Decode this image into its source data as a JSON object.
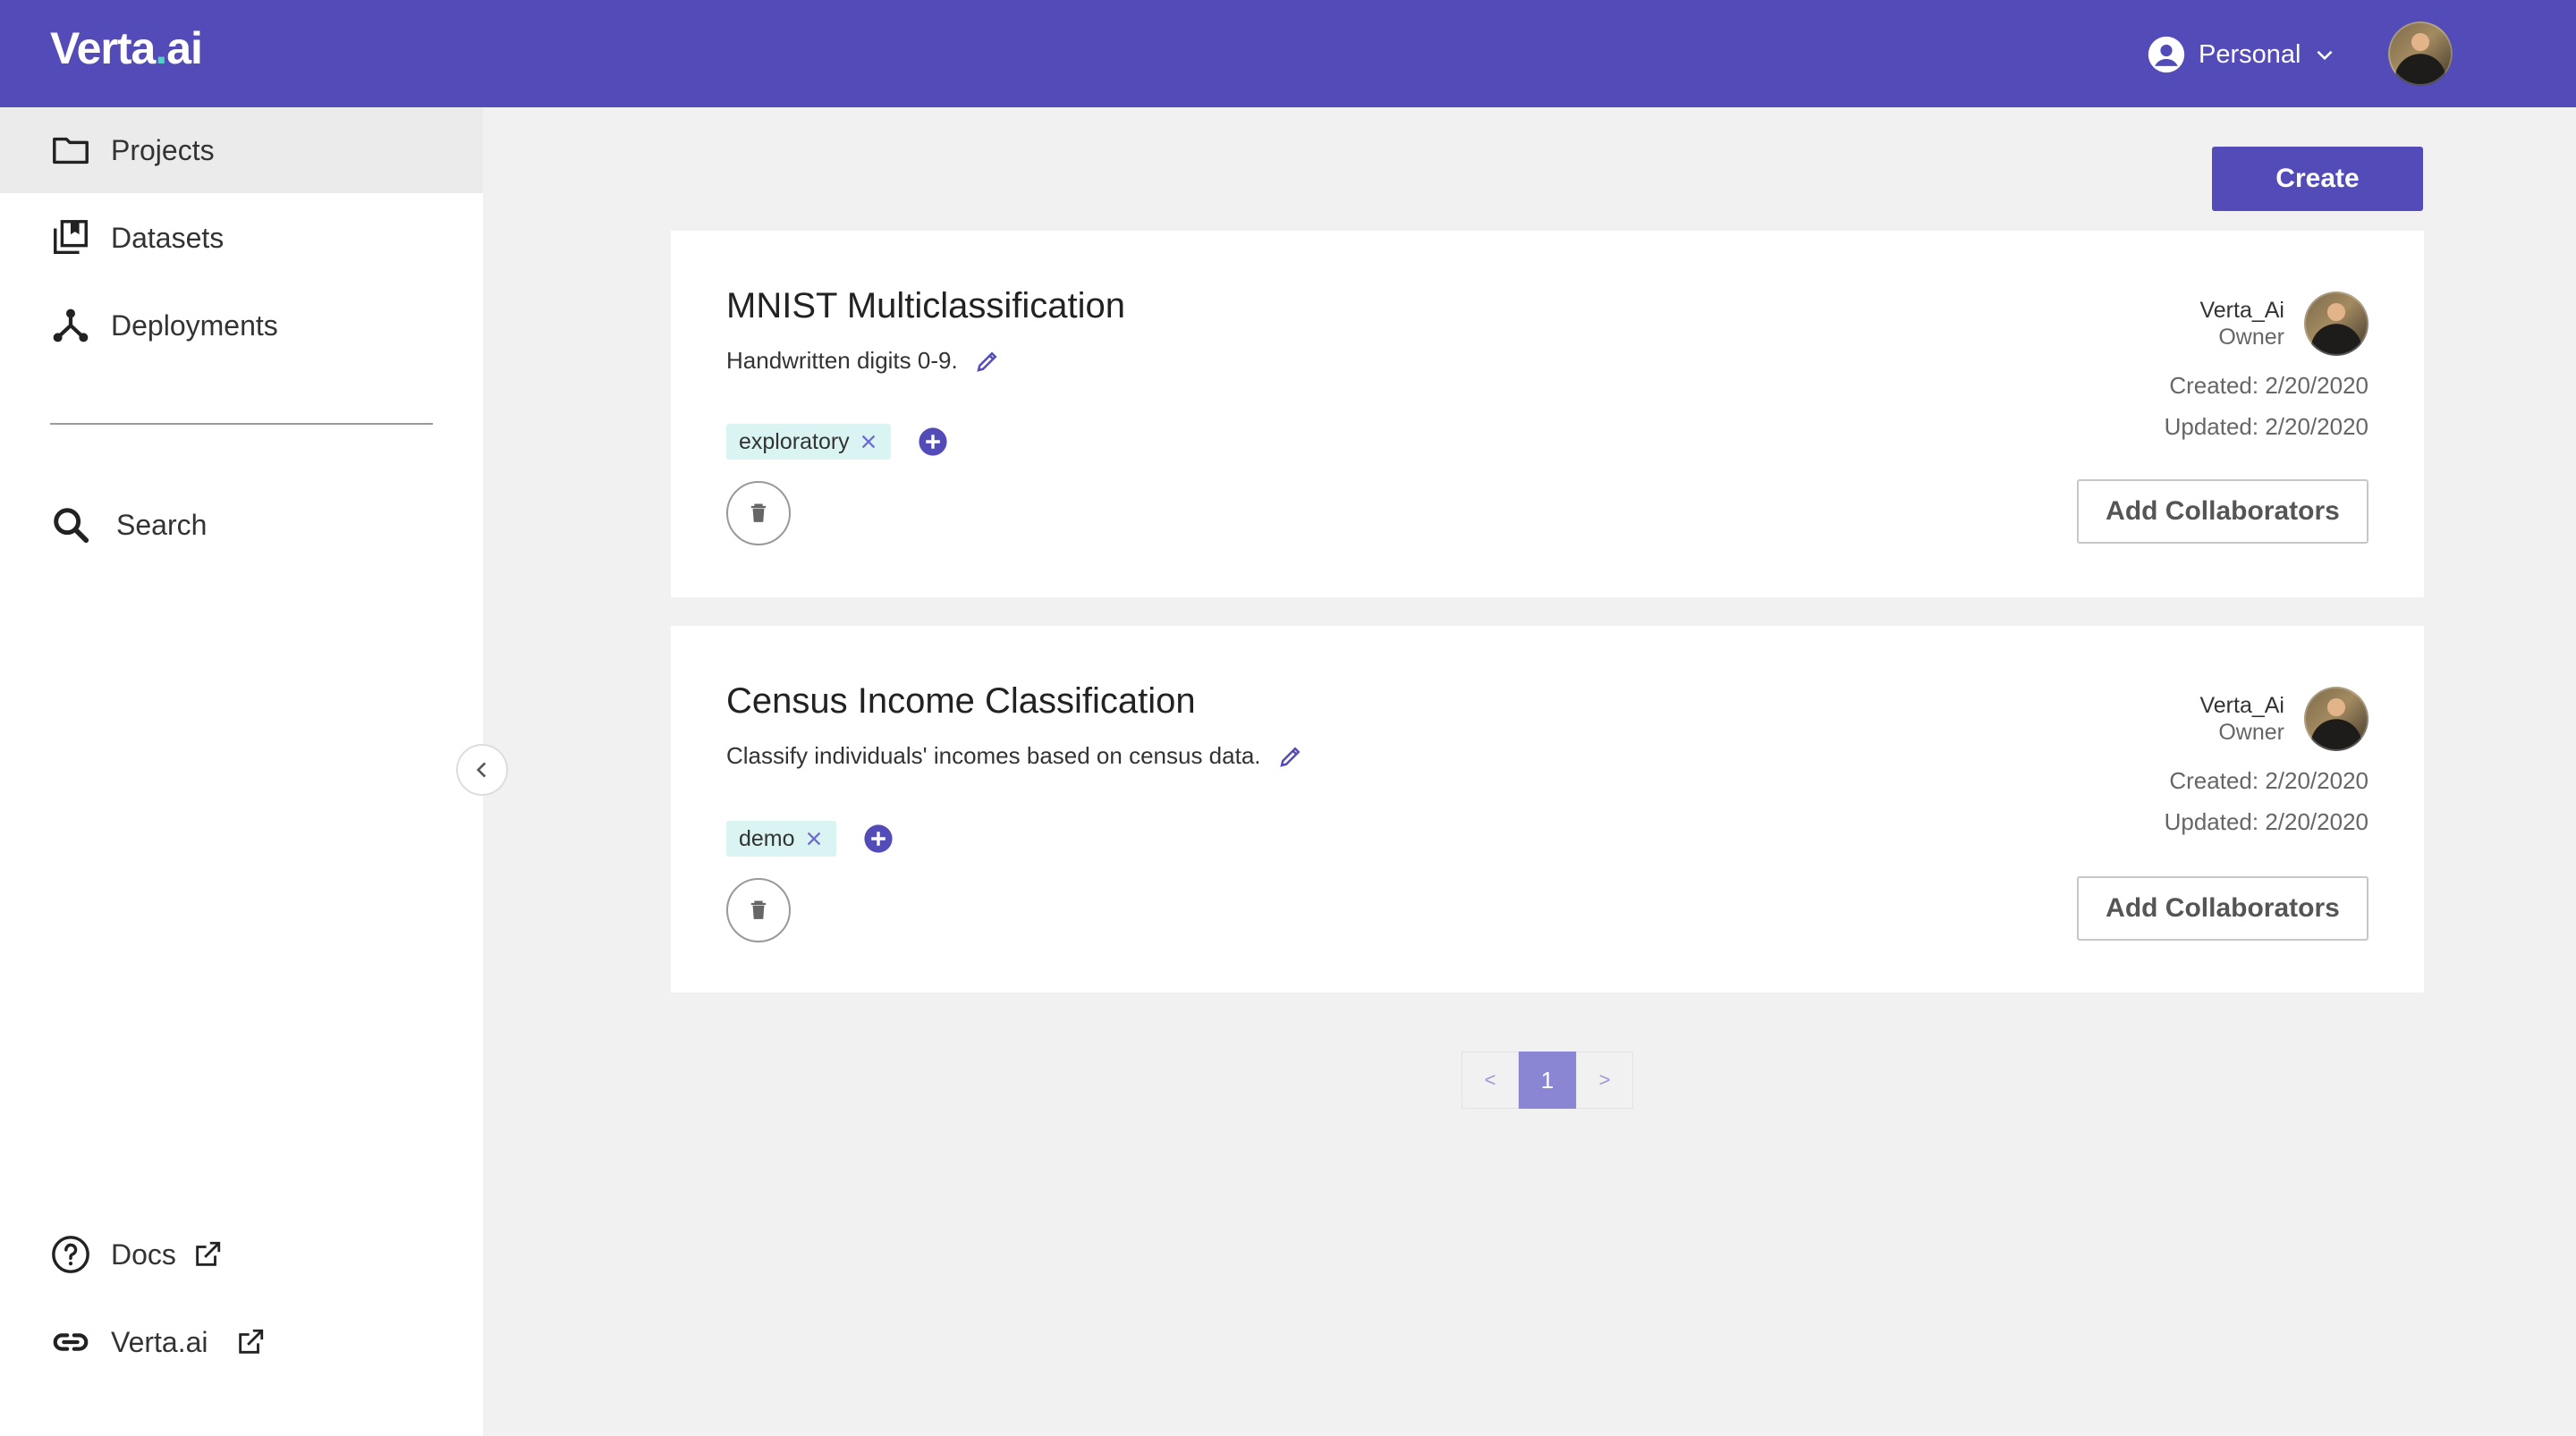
{
  "header": {
    "logo_main": "Verta",
    "logo_dot": ".",
    "logo_suffix": "ai",
    "workspace_label": "Personal"
  },
  "sidebar": {
    "items": [
      {
        "label": "Projects",
        "icon": "folder-icon",
        "active": true
      },
      {
        "label": "Datasets",
        "icon": "datasets-icon"
      },
      {
        "label": "Deployments",
        "icon": "deployments-icon"
      }
    ],
    "search_label": "Search",
    "footer": [
      {
        "label": "Docs",
        "icon": "help-circle-icon"
      },
      {
        "label": "Verta.ai",
        "icon": "link-icon"
      }
    ]
  },
  "main": {
    "create_label": "Create",
    "projects": [
      {
        "title": "MNIST Multiclassification",
        "description": "Handwritten digits 0-9.",
        "tags": [
          "exploratory"
        ],
        "owner_name": "Verta_Ai",
        "owner_role": "Owner",
        "created": "Created: 2/20/2020",
        "updated": "Updated: 2/20/2020",
        "collab_label": "Add Collaborators"
      },
      {
        "title": "Census Income Classification",
        "description": "Classify individuals' incomes based on census data.",
        "tags": [
          "demo"
        ],
        "owner_name": "Verta_Ai",
        "owner_role": "Owner",
        "created": "Created: 2/20/2020",
        "updated": "Updated: 2/20/2020",
        "collab_label": "Add Collaborators"
      }
    ],
    "pagination": {
      "prev": "<",
      "current": "1",
      "next": ">"
    }
  },
  "colors": {
    "brand": "#534bb8",
    "tag_bg": "#d9f4f2",
    "logo_dot": "#4fd1c5"
  }
}
